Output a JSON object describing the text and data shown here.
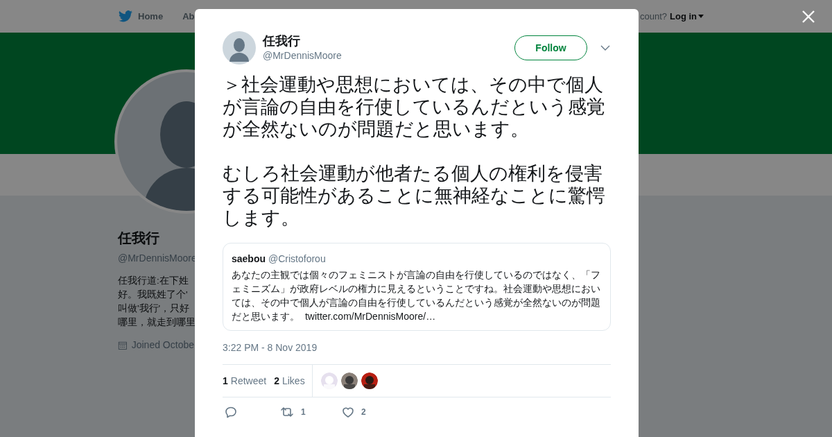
{
  "nav": {
    "home": "Home",
    "about": "Ab",
    "account": "count?",
    "login": "Log in"
  },
  "profile": {
    "name": "任我行",
    "handle": "@MrDennisMoore",
    "bio": [
      "任我行道:在下姓",
      "好。我既姓了个'",
      "叫做'我行'，只好",
      "哪里，就走到哪里"
    ],
    "joined": "Joined Octobe"
  },
  "tweet": {
    "name": "任我行",
    "handle": "@MrDennisMoore",
    "follow": "Follow",
    "paragraphs": [
      "＞社会運動や思想においては、その中で個人が言論の自由を行使しているんだという感覚が全然ないのが問題だと思います。",
      "むしろ社会運動が他者たる個人の権利を侵害する可能性があることに無神経なことに驚愕します。"
    ],
    "quote": {
      "name": "saebou",
      "handle": "@Cristoforou",
      "text": "あなたの主観では個々のフェミニストが言論の自由を行使しているのではなく、「フェミニズム」が政府レベルの権力に見えるということですね。社会運動や思想においては、その中で個人が言論の自由を行使しているんだという感覚が全然ないのが問題だと思います。",
      "link": "twitter.com/MrDennisMoore/…"
    },
    "time": "3:22 PM - 8 Nov 2019",
    "stats": [
      {
        "count": "1",
        "label": "Retweet"
      },
      {
        "count": "2",
        "label": "Likes"
      }
    ],
    "likers": [
      {
        "kind": "picture"
      },
      {
        "kind": "picture"
      },
      {
        "kind": "picture"
      }
    ],
    "actions": [
      {
        "kind": "reply"
      },
      {
        "kind": "retweet",
        "count": "1"
      },
      {
        "kind": "like",
        "count": "2"
      }
    ]
  }
}
